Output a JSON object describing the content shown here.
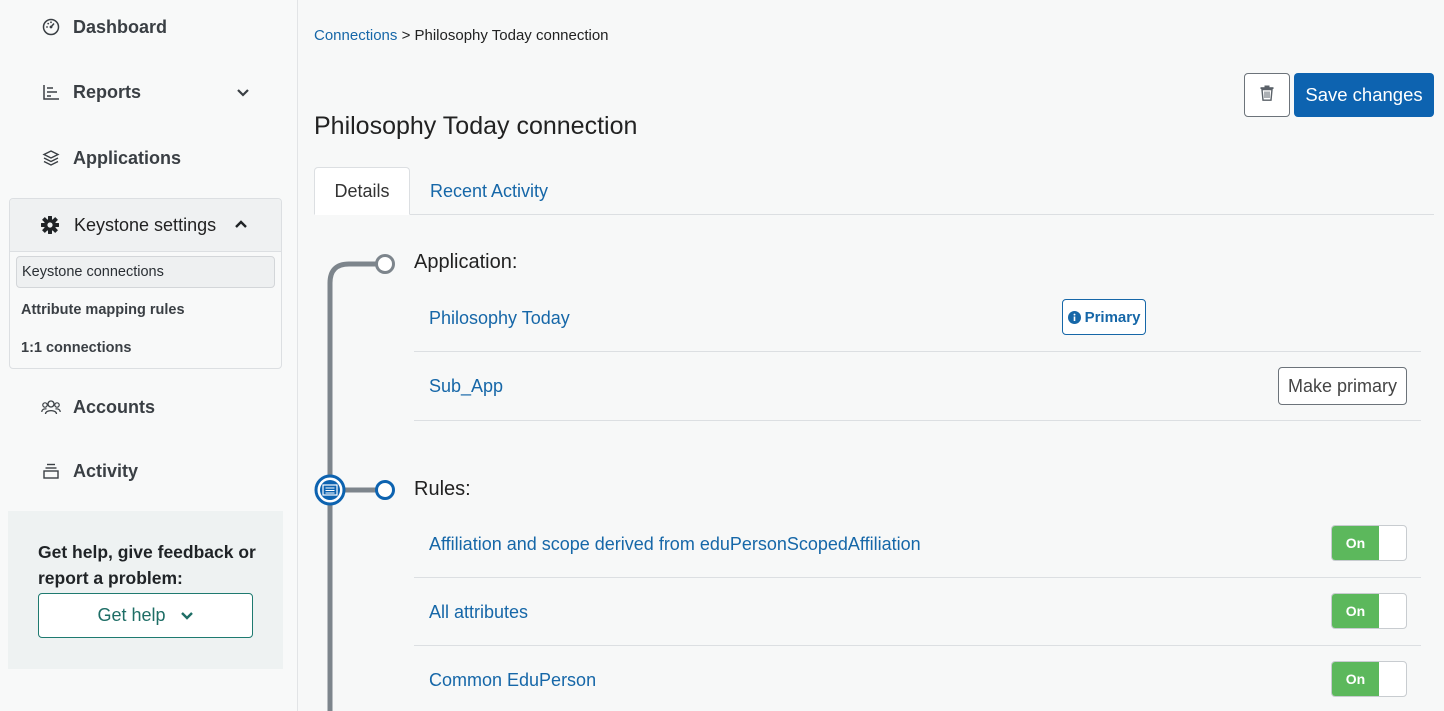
{
  "sidebar": {
    "items": [
      {
        "label": "Dashboard",
        "icon": "dashboard-icon"
      },
      {
        "label": "Reports",
        "icon": "bar-chart-icon"
      },
      {
        "label": "Applications",
        "icon": "layers-icon"
      },
      {
        "label": "Keystone settings",
        "icon": "gear-icon"
      },
      {
        "label": "Accounts",
        "icon": "users-icon"
      },
      {
        "label": "Activity",
        "icon": "activity-icon"
      }
    ],
    "keystone_sub": [
      {
        "label": "Keystone connections"
      },
      {
        "label": "Attribute mapping rules"
      },
      {
        "label": "1:1 connections"
      }
    ],
    "help": {
      "text": "Get help, give feedback or report a problem:",
      "button": "Get help"
    }
  },
  "breadcrumb": {
    "parent": "Connections",
    "separator": ">",
    "current": "Philosophy Today connection"
  },
  "header": {
    "title": "Philosophy Today connection",
    "save_label": "Save changes"
  },
  "tabs": [
    {
      "label": "Details"
    },
    {
      "label": "Recent Activity"
    }
  ],
  "application": {
    "heading": "Application:",
    "items": [
      {
        "name": "Philosophy Today",
        "badge": "Primary"
      },
      {
        "name": "Sub_App",
        "action": "Make primary"
      }
    ]
  },
  "rules": {
    "heading": "Rules:",
    "items": [
      {
        "name": "Affiliation and scope derived from eduPersonScopedAffiliation",
        "state": "On"
      },
      {
        "name": "All attributes",
        "state": "On"
      },
      {
        "name": "Common EduPerson",
        "state": "On"
      }
    ]
  },
  "colors": {
    "accent": "#1667a8",
    "primary_button": "#0d63b0",
    "toggle_on": "#5cb85c",
    "timeline": "#7d858c",
    "help_border": "#1e7a70"
  }
}
